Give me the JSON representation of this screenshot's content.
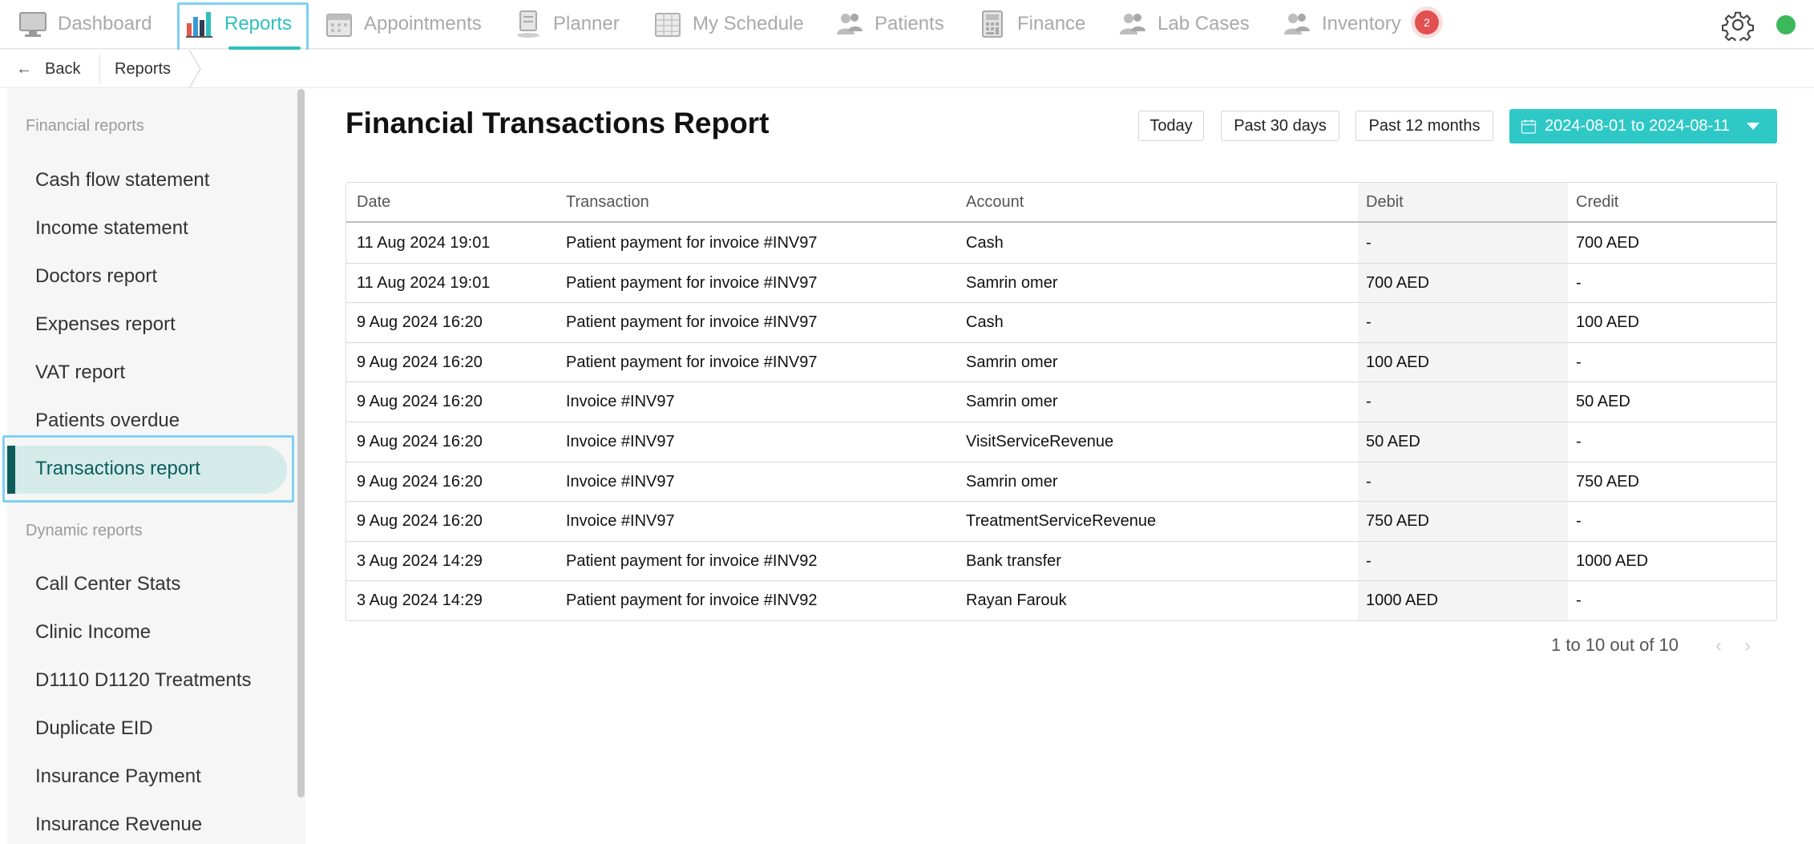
{
  "nav": {
    "items": [
      {
        "label": "Dashboard",
        "icon": "monitor-icon"
      },
      {
        "label": "Reports",
        "icon": "bar-chart-icon"
      },
      {
        "label": "Appointments",
        "icon": "calendar-icon"
      },
      {
        "label": "Planner",
        "icon": "planner-icon"
      },
      {
        "label": "My Schedule",
        "icon": "schedule-icon"
      },
      {
        "label": "Patients",
        "icon": "patients-icon"
      },
      {
        "label": "Finance",
        "icon": "calculator-icon"
      },
      {
        "label": "Lab Cases",
        "icon": "lab-cases-icon"
      },
      {
        "label": "Inventory",
        "icon": "inventory-icon"
      }
    ],
    "inventory_badge": "2",
    "accent": "#2fbfbf"
  },
  "breadcrumb": {
    "back_label": "Back",
    "current": "Reports"
  },
  "sidebar": {
    "financial_heading": "Financial reports",
    "financial_items": [
      "Cash flow statement",
      "Income statement",
      "Doctors report",
      "Expenses report",
      "VAT report",
      "Patients overdue",
      "Transactions report"
    ],
    "active_item": "Transactions report",
    "dynamic_heading": "Dynamic reports",
    "dynamic_items": [
      "Call Center Stats",
      "Clinic Income",
      "D1110 D1120 Treatments",
      "Duplicate EID",
      "Insurance Payment",
      "Insurance Revenue"
    ]
  },
  "main": {
    "title": "Financial Transactions Report",
    "period_buttons": [
      "Today",
      "Past 30 days",
      "Past 12 months"
    ],
    "date_range": "2024-08-01 to 2024-08-11",
    "columns": [
      "Date",
      "Transaction",
      "Account",
      "Debit",
      "Credit"
    ],
    "rows": [
      [
        "11 Aug 2024 19:01",
        "Patient payment for invoice #INV97",
        "Cash",
        "-",
        "700 AED"
      ],
      [
        "11 Aug 2024 19:01",
        "Patient payment for invoice #INV97",
        "Samrin omer",
        "700 AED",
        "-"
      ],
      [
        "9 Aug 2024 16:20",
        "Patient payment for invoice #INV97",
        "Cash",
        "-",
        "100 AED"
      ],
      [
        "9 Aug 2024 16:20",
        "Patient payment for invoice #INV97",
        "Samrin omer",
        "100 AED",
        "-"
      ],
      [
        "9 Aug 2024 16:20",
        "Invoice #INV97",
        "Samrin omer",
        "-",
        "50 AED"
      ],
      [
        "9 Aug 2024 16:20",
        "Invoice #INV97",
        "VisitServiceRevenue",
        "50 AED",
        "-"
      ],
      [
        "9 Aug 2024 16:20",
        "Invoice #INV97",
        "Samrin omer",
        "-",
        "750 AED"
      ],
      [
        "9 Aug 2024 16:20",
        "Invoice #INV97",
        "TreatmentServiceRevenue",
        "750 AED",
        "-"
      ],
      [
        "3 Aug 2024 14:29",
        "Patient payment for invoice #INV92",
        "Bank transfer",
        "-",
        "1000 AED"
      ],
      [
        "3 Aug 2024 14:29",
        "Patient payment for invoice #INV92",
        "Rayan Farouk",
        "1000 AED",
        "-"
      ]
    ],
    "pagination": "1 to 10 out of 10"
  }
}
